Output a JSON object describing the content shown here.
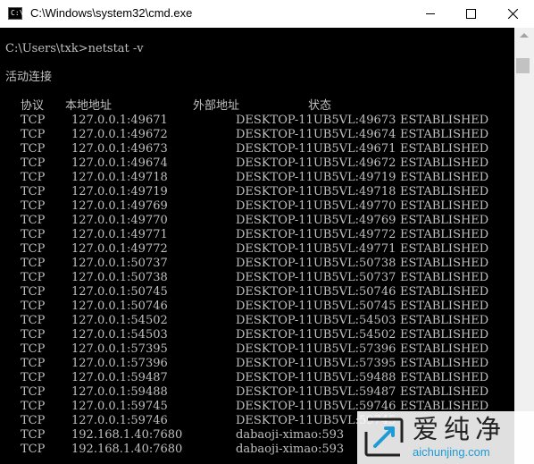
{
  "window": {
    "title": "C:\\Windows\\system32\\cmd.exe",
    "icon": "cmd-icon"
  },
  "console": {
    "command_line": "C:\\Users\\txk>netstat -v",
    "section_title": "活动连接",
    "columns": {
      "proto": "协议",
      "local": "本地地址",
      "foreign": "外部地址",
      "state": "状态"
    },
    "rows": [
      {
        "proto": "TCP",
        "local": "127.0.0.1:49671",
        "foreign": "DESKTOP-11UB5VL:49673",
        "state": "ESTABLISHED"
      },
      {
        "proto": "TCP",
        "local": "127.0.0.1:49672",
        "foreign": "DESKTOP-11UB5VL:49674",
        "state": "ESTABLISHED"
      },
      {
        "proto": "TCP",
        "local": "127.0.0.1:49673",
        "foreign": "DESKTOP-11UB5VL:49671",
        "state": "ESTABLISHED"
      },
      {
        "proto": "TCP",
        "local": "127.0.0.1:49674",
        "foreign": "DESKTOP-11UB5VL:49672",
        "state": "ESTABLISHED"
      },
      {
        "proto": "TCP",
        "local": "127.0.0.1:49718",
        "foreign": "DESKTOP-11UB5VL:49719",
        "state": "ESTABLISHED"
      },
      {
        "proto": "TCP",
        "local": "127.0.0.1:49719",
        "foreign": "DESKTOP-11UB5VL:49718",
        "state": "ESTABLISHED"
      },
      {
        "proto": "TCP",
        "local": "127.0.0.1:49769",
        "foreign": "DESKTOP-11UB5VL:49770",
        "state": "ESTABLISHED"
      },
      {
        "proto": "TCP",
        "local": "127.0.0.1:49770",
        "foreign": "DESKTOP-11UB5VL:49769",
        "state": "ESTABLISHED"
      },
      {
        "proto": "TCP",
        "local": "127.0.0.1:49771",
        "foreign": "DESKTOP-11UB5VL:49772",
        "state": "ESTABLISHED"
      },
      {
        "proto": "TCP",
        "local": "127.0.0.1:49772",
        "foreign": "DESKTOP-11UB5VL:49771",
        "state": "ESTABLISHED"
      },
      {
        "proto": "TCP",
        "local": "127.0.0.1:50737",
        "foreign": "DESKTOP-11UB5VL:50738",
        "state": "ESTABLISHED"
      },
      {
        "proto": "TCP",
        "local": "127.0.0.1:50738",
        "foreign": "DESKTOP-11UB5VL:50737",
        "state": "ESTABLISHED"
      },
      {
        "proto": "TCP",
        "local": "127.0.0.1:50745",
        "foreign": "DESKTOP-11UB5VL:50746",
        "state": "ESTABLISHED"
      },
      {
        "proto": "TCP",
        "local": "127.0.0.1:50746",
        "foreign": "DESKTOP-11UB5VL:50745",
        "state": "ESTABLISHED"
      },
      {
        "proto": "TCP",
        "local": "127.0.0.1:54502",
        "foreign": "DESKTOP-11UB5VL:54503",
        "state": "ESTABLISHED"
      },
      {
        "proto": "TCP",
        "local": "127.0.0.1:54503",
        "foreign": "DESKTOP-11UB5VL:54502",
        "state": "ESTABLISHED"
      },
      {
        "proto": "TCP",
        "local": "127.0.0.1:57395",
        "foreign": "DESKTOP-11UB5VL:57396",
        "state": "ESTABLISHED"
      },
      {
        "proto": "TCP",
        "local": "127.0.0.1:57396",
        "foreign": "DESKTOP-11UB5VL:57395",
        "state": "ESTABLISHED"
      },
      {
        "proto": "TCP",
        "local": "127.0.0.1:59487",
        "foreign": "DESKTOP-11UB5VL:59488",
        "state": "ESTABLISHED"
      },
      {
        "proto": "TCP",
        "local": "127.0.0.1:59488",
        "foreign": "DESKTOP-11UB5VL:59487",
        "state": "ESTABLISHED"
      },
      {
        "proto": "TCP",
        "local": "127.0.0.1:59745",
        "foreign": "DESKTOP-11UB5VL:59746",
        "state": "ESTABLISHED"
      },
      {
        "proto": "TCP",
        "local": "127.0.0.1:59746",
        "foreign": "DESKTOP-11UB5VL:59745",
        "state": ""
      },
      {
        "proto": "TCP",
        "local": "192.168.1.40:7680",
        "foreign": "dabaoji-ximao:593",
        "state": ""
      },
      {
        "proto": "TCP",
        "local": "192.168.1.40:7680",
        "foreign": "dabaoji-ximao:593",
        "state": ""
      }
    ]
  },
  "watermark": {
    "chinese": "爱纯净",
    "url": "aichunjing.com",
    "accent_color": "#1e9bd6"
  },
  "colors": {
    "console_bg": "#000000",
    "console_text": "#c0c0c0",
    "titlebar_bg": "#ffffff"
  }
}
